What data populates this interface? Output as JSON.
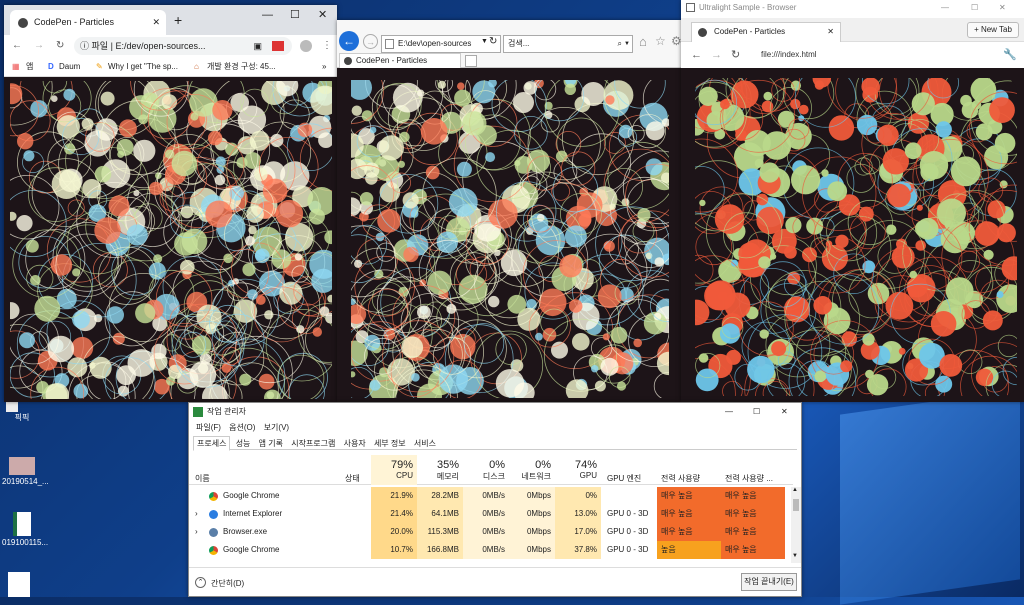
{
  "desktop": {
    "icons": [
      {
        "label": "픽픽"
      },
      {
        "label": "20190514_..."
      },
      {
        "label": "019100115..."
      }
    ]
  },
  "chrome": {
    "tab_title": "CodePen - Particles",
    "address_prefix": "파일",
    "address": "E:/dev/open-sources...",
    "bookmarks": [
      "앱",
      "Daum",
      "Why I get \"The sp...",
      "개발 환경 구성: 45..."
    ],
    "more": "»"
  },
  "ie": {
    "address": "E:\\dev\\open-sources",
    "search_placeholder": "검색...",
    "tab_title": "CodePen - Particles"
  },
  "ultralight": {
    "window_title": "Ultralight Sample - Browser",
    "tab_title": "CodePen - Particles",
    "new_tab": "+ New Tab",
    "address": "file:///index.html"
  },
  "taskmgr": {
    "title": "작업 관리자",
    "menu": [
      "파일(F)",
      "옵션(O)",
      "보기(V)"
    ],
    "tabs": [
      "프로세스",
      "성능",
      "앱 기록",
      "시작프로그램",
      "사용자",
      "세부 정보",
      "서비스"
    ],
    "columns": {
      "name": "이름",
      "status": "상태",
      "cpu_pct": "79%",
      "cpu": "CPU",
      "mem_pct": "35%",
      "mem": "메모리",
      "disk_pct": "0%",
      "disk": "디스크",
      "net_pct": "0%",
      "net": "네트워크",
      "gpu_pct": "74%",
      "gpu": "GPU",
      "gpu_engine": "GPU 엔진",
      "power": "전력 사용량",
      "power_trend": "전력 사용량 ..."
    },
    "rows": [
      {
        "name": "Google Chrome",
        "cpu": "21.9%",
        "mem": "28.2MB",
        "disk": "0MB/s",
        "net": "0Mbps",
        "gpu": "0%",
        "engine": "",
        "power": "매우 높음",
        "power_trend": "매우 높음"
      },
      {
        "name": "Internet Explorer",
        "cpu": "21.4%",
        "mem": "64.1MB",
        "disk": "0MB/s",
        "net": "0Mbps",
        "gpu": "13.0%",
        "engine": "GPU 0 - 3D",
        "power": "매우 높음",
        "power_trend": "매우 높음"
      },
      {
        "name": "Browser.exe",
        "cpu": "20.0%",
        "mem": "115.3MB",
        "disk": "0MB/s",
        "net": "0Mbps",
        "gpu": "17.0%",
        "engine": "GPU 0 - 3D",
        "power": "매우 높음",
        "power_trend": "매우 높음"
      },
      {
        "name": "Google Chrome",
        "cpu": "10.7%",
        "mem": "166.8MB",
        "disk": "0MB/s",
        "net": "0Mbps",
        "gpu": "37.8%",
        "engine": "GPU 0 - 3D",
        "power": "높음",
        "power_trend": "매우 높음"
      }
    ],
    "fewer_details": "간단히(D)",
    "end_task": "작업 끝내기(E)"
  }
}
